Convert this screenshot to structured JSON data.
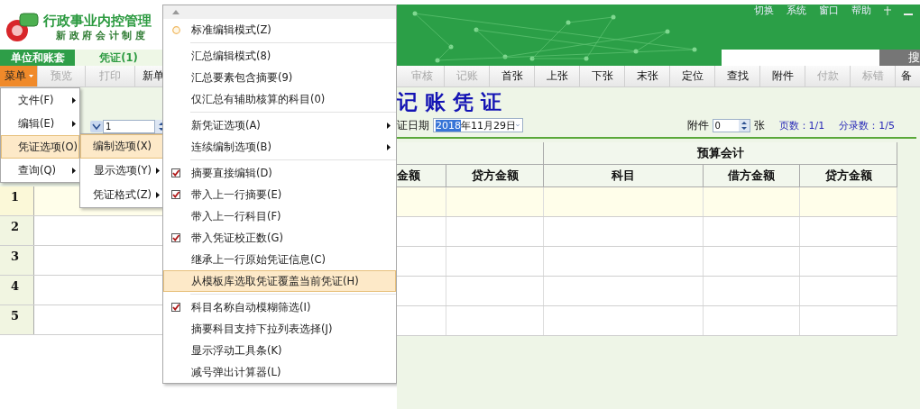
{
  "app": {
    "title": "行政事业内控管理",
    "subtitle": "新 政 府 会 计 制 度"
  },
  "top_menu": [
    "切换",
    "系统",
    "窗口",
    "帮助"
  ],
  "search": {
    "button": "搜"
  },
  "tabs": [
    {
      "label": "单位和账套",
      "selected": false
    },
    {
      "label": "凭证(1)",
      "selected": true
    }
  ],
  "toolbar_left": [
    {
      "label": "菜单",
      "kind": "menu",
      "disabled": false
    },
    {
      "label": "预览",
      "kind": "button",
      "disabled": true
    },
    {
      "label": "打印",
      "kind": "button",
      "disabled": true
    },
    {
      "label": "新单",
      "kind": "button",
      "disabled": false
    }
  ],
  "toolbar_right": [
    {
      "label": "审核",
      "disabled": true
    },
    {
      "label": "记账",
      "disabled": true
    },
    {
      "label": "首张",
      "disabled": false
    },
    {
      "label": "上张",
      "disabled": false
    },
    {
      "label": "下张",
      "disabled": false
    },
    {
      "label": "末张",
      "disabled": false
    },
    {
      "label": "定位",
      "disabled": false
    },
    {
      "label": "查找",
      "disabled": false
    },
    {
      "label": "附件",
      "disabled": false
    },
    {
      "label": "付款",
      "disabled": true
    },
    {
      "label": "标错",
      "disabled": true
    },
    {
      "label": "备",
      "disabled": false
    }
  ],
  "voucher": {
    "number": "1",
    "title": "记 账 凭 证",
    "date_label": "证日期",
    "date_selected": "2018",
    "date_rest": "年11月29日",
    "attach_label": "附件",
    "attach_value": "0",
    "attach_unit": "张",
    "pages": "页数：1/1",
    "entries": "分录数：1/5"
  },
  "table": {
    "group_header": "预算会计",
    "columns": [
      "金额",
      "贷方金额",
      "科目",
      "借方金额",
      "贷方金额"
    ],
    "rows": [
      {
        "number": "1",
        "selected": true
      },
      {
        "number": "2",
        "selected": false
      },
      {
        "number": "3",
        "selected": false
      },
      {
        "number": "4",
        "selected": false
      },
      {
        "number": "5",
        "selected": false
      }
    ]
  },
  "main_menu": [
    {
      "label": "文件(F)",
      "kind": "submenu",
      "selected": false
    },
    {
      "label": "编辑(E)",
      "kind": "submenu",
      "selected": false
    },
    {
      "label": "凭证选项(O)",
      "kind": "command",
      "selected": true
    },
    {
      "label": "查询(Q)",
      "kind": "submenu",
      "selected": false
    }
  ],
  "sub_menu": [
    {
      "label": "编制选项(X)",
      "kind": "command",
      "selected": true
    },
    {
      "label": "显示选项(Y)",
      "kind": "submenu",
      "selected": false
    },
    {
      "label": "凭证格式(Z)",
      "kind": "submenu",
      "selected": false
    }
  ],
  "options_menu": [
    {
      "label": "标准编辑模式(Z)",
      "kind": "radio",
      "checked": true,
      "selected": false,
      "separator_after": true
    },
    {
      "label": "汇总编辑模式(8)",
      "kind": "radio",
      "checked": false,
      "selected": false,
      "separator_after": false
    },
    {
      "label": "汇总要素包含摘要(9)",
      "kind": "check",
      "checked": false,
      "selected": false,
      "separator_after": false
    },
    {
      "label": "仅汇总有辅助核算的科目(0)",
      "kind": "check",
      "checked": false,
      "selected": false,
      "separator_after": true
    },
    {
      "label": "新凭证选项(A)",
      "kind": "submenu",
      "selected": false,
      "separator_after": false
    },
    {
      "label": "连续编制选项(B)",
      "kind": "submenu",
      "selected": false,
      "separator_after": true
    },
    {
      "label": "摘要直接编辑(D)",
      "kind": "check",
      "checked": true,
      "selected": false,
      "separator_after": false
    },
    {
      "label": "带入上一行摘要(E)",
      "kind": "check",
      "checked": true,
      "selected": false,
      "separator_after": false
    },
    {
      "label": "带入上一行科目(F)",
      "kind": "check",
      "checked": false,
      "selected": false,
      "separator_after": false
    },
    {
      "label": "带入凭证校正数(G)",
      "kind": "check",
      "checked": true,
      "selected": false,
      "separator_after": false
    },
    {
      "label": "继承上一行原始凭证信息(C)",
      "kind": "check",
      "checked": false,
      "selected": false,
      "separator_after": false
    },
    {
      "label": "从模板库选取凭证覆盖当前凭证(H)",
      "kind": "command",
      "selected": true,
      "separator_after": true
    },
    {
      "label": "科目名称自动模糊筛选(I)",
      "kind": "check",
      "checked": true,
      "selected": false,
      "separator_after": false
    },
    {
      "label": "摘要科目支持下拉列表选择(J)",
      "kind": "check",
      "checked": false,
      "selected": false,
      "separator_after": false
    },
    {
      "label": "显示浮动工具条(K)",
      "kind": "check",
      "checked": false,
      "selected": false,
      "separator_after": false
    },
    {
      "label": "减号弹出计算器(L)",
      "kind": "check",
      "checked": false,
      "selected": false,
      "separator_after": false
    }
  ]
}
